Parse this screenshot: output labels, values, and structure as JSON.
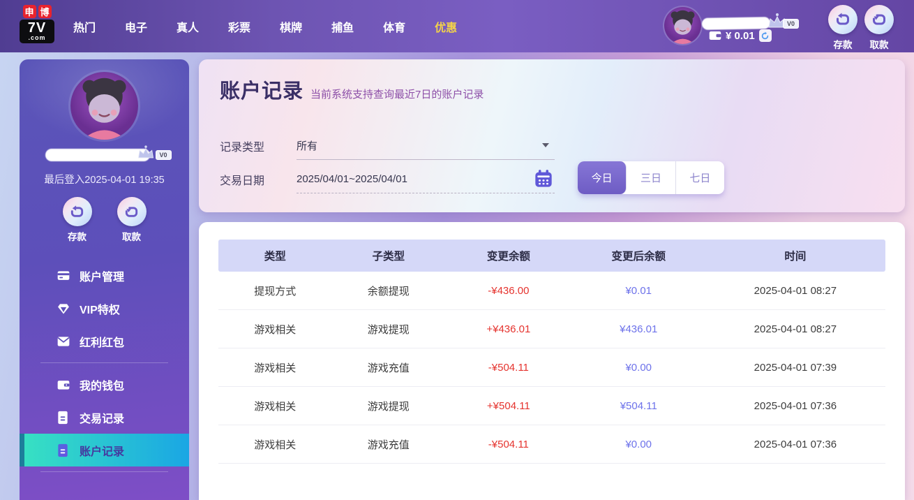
{
  "topnav": {
    "logo": {
      "badge1": "申",
      "badge2": "博",
      "brand": "7V",
      "suffix": ".com"
    },
    "items": [
      {
        "label": "热门"
      },
      {
        "label": "电子"
      },
      {
        "label": "真人"
      },
      {
        "label": "彩票"
      },
      {
        "label": "棋牌"
      },
      {
        "label": "捕鱼"
      },
      {
        "label": "体育"
      },
      {
        "label": "优惠"
      }
    ]
  },
  "user": {
    "vip_badge": "V0",
    "balance": "¥ 0.01",
    "deposit_label": "存款",
    "withdraw_label": "取款"
  },
  "sidebar": {
    "vip_badge": "V0",
    "last_login": "最后登入2025-04-01 19:35",
    "deposit_label": "存款",
    "withdraw_label": "取款",
    "menu": [
      {
        "label": "账户管理",
        "icon": "bank-card-icon",
        "selected": false
      },
      {
        "label": "VIP特权",
        "icon": "vip-gem-icon",
        "selected": false
      },
      {
        "label": "红利红包",
        "icon": "red-packet-icon",
        "selected": false
      },
      {
        "label": "我的钱包",
        "icon": "wallet-icon",
        "selected": false
      },
      {
        "label": "交易记录",
        "icon": "transaction-doc-icon",
        "selected": false
      },
      {
        "label": "账户记录",
        "icon": "account-doc-icon",
        "selected": true
      }
    ]
  },
  "main": {
    "title": "账户记录",
    "subtitle": "当前系统支持查询最近7日的账户记录",
    "filters": {
      "type_label": "记录类型",
      "type_value": "所有",
      "date_label": "交易日期",
      "date_value": "2025/04/01~2025/04/01",
      "range_buttons": [
        {
          "label": "今日",
          "selected": true
        },
        {
          "label": "三日",
          "selected": false
        },
        {
          "label": "七日",
          "selected": false
        }
      ]
    },
    "table": {
      "headers": [
        "类型",
        "子类型",
        "变更余额",
        "变更后余额",
        "时间"
      ],
      "rows": [
        {
          "type": "提现方式",
          "subtype": "余额提现",
          "change": "-¥436.00",
          "after": "¥0.01",
          "time": "2025-04-01 08:27"
        },
        {
          "type": "游戏相关",
          "subtype": "游戏提现",
          "change": "+¥436.01",
          "after": "¥436.01",
          "time": "2025-04-01 08:27"
        },
        {
          "type": "游戏相关",
          "subtype": "游戏充值",
          "change": "-¥504.11",
          "after": "¥0.00",
          "time": "2025-04-01 07:39"
        },
        {
          "type": "游戏相关",
          "subtype": "游戏提现",
          "change": "+¥504.11",
          "after": "¥504.11",
          "time": "2025-04-01 07:36"
        },
        {
          "type": "游戏相关",
          "subtype": "游戏充值",
          "change": "-¥504.11",
          "after": "¥0.00",
          "time": "2025-04-01 07:36"
        }
      ]
    }
  },
  "colors": {
    "nav_highlight": "#f2d24a",
    "accent_purple": "#6e5cc4",
    "selected_gradient_start": "#38e2c2",
    "selected_gradient_end": "#1aa6e4",
    "negative_red": "#e5332e",
    "balance_blue": "#6d72ea"
  }
}
